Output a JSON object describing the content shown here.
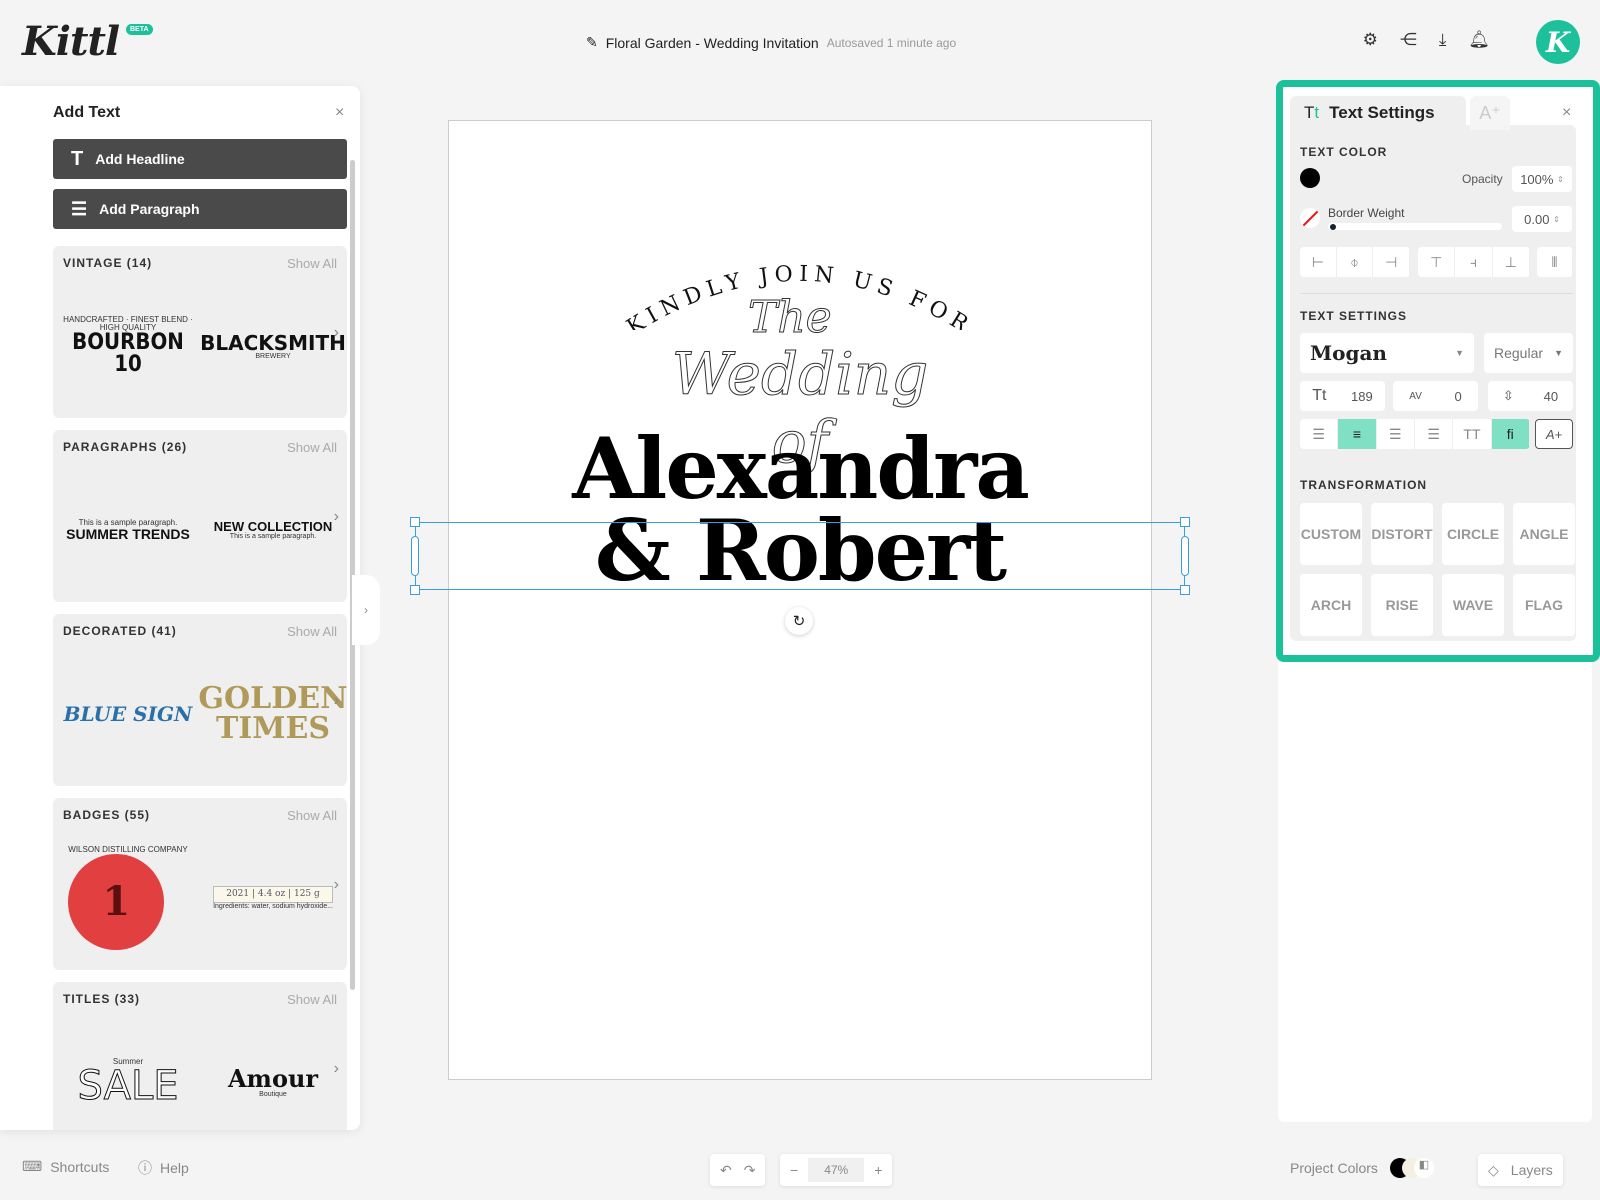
{
  "app": {
    "logo": "Kittl",
    "badge": "BETA",
    "avatar_letter": "K",
    "accent": "#1cc09a"
  },
  "header": {
    "project_title": "Floral Garden - Wedding Invitation",
    "autosave": "Autosaved 1 minute ago",
    "icons": [
      "gear-icon",
      "share-icon",
      "download-icon",
      "bell-icon"
    ]
  },
  "rail": {
    "icons": [
      "edit-icon",
      "template-icon",
      "text-icon",
      "shapes-icon",
      "upload-icon",
      "camera-icon",
      "pattern-icon"
    ],
    "text_icon": "Tt"
  },
  "left_panel": {
    "title": "Add Text",
    "add_headline": "Add Headline",
    "add_paragraph": "Add Paragraph",
    "show_all": "Show All",
    "categories": [
      {
        "title": "VINTAGE (14)",
        "a": "BOURBON 10",
        "a_sub": "HANDCRAFTED · FINEST BLEND · HIGH QUALITY",
        "b": "BLACKSMITH",
        "b_sub": "BREWERY"
      },
      {
        "title": "PARAGRAPHS (26)",
        "a": "SUMMER TRENDS",
        "a_sub": "This is a sample paragraph.",
        "b": "NEW COLLECTION",
        "b_sub": "This is a sample paragraph."
      },
      {
        "title": "DECORATED (41)",
        "a": "BLUE SIGN",
        "a_sub": "",
        "b": "GOLDEN TIMES",
        "b_sub": ""
      },
      {
        "title": "BADGES (55)",
        "a": "1",
        "a_sub": "WILSON DISTILLING COMPANY",
        "b": "2021 | 4.4 oz | 125 g",
        "b_sub": "Ingredients: water, sodium hydroxide..."
      },
      {
        "title": "TITLES (33)",
        "a": "SALE",
        "a_sub": "Summer",
        "b": "Amour",
        "b_sub": "Boutique"
      }
    ]
  },
  "canvas": {
    "arc_text": "KINDLY JOIN US FOR",
    "line_the": "The",
    "line_wedding": "Wedding of",
    "line_name1": "Alexandra",
    "line_name2": "& Robert"
  },
  "right_panel": {
    "tab": "Text Settings",
    "text_color_label": "TEXT COLOR",
    "text_color": "#000000",
    "opacity_label": "Opacity",
    "opacity": "100%",
    "border_label": "Border Weight",
    "border_value": "0.00",
    "border_fraction": 0,
    "text_settings_label": "TEXT SETTINGS",
    "font": "Mogan",
    "weight": "Regular",
    "font_size": "189",
    "letter_spacing": "0",
    "line_height": "40",
    "size_icon": "Tt",
    "spacing_icon": "AV",
    "uppercase_label": "TT",
    "ligature_label": "fi",
    "effects_label": "A+",
    "alignment": "center",
    "transformation_label": "TRANSFORMATION",
    "transforms": [
      "CUSTOM",
      "DISTORT",
      "CIRCLE",
      "ANGLE",
      "ARCH",
      "RISE",
      "WAVE",
      "FLAG"
    ]
  },
  "footer": {
    "shortcuts": "Shortcuts",
    "help": "Help",
    "zoom": "47%",
    "minus": "−",
    "plus": "+",
    "project_colors": "Project Colors",
    "layers": "Layers",
    "undo": "↶",
    "redo": "↷"
  }
}
